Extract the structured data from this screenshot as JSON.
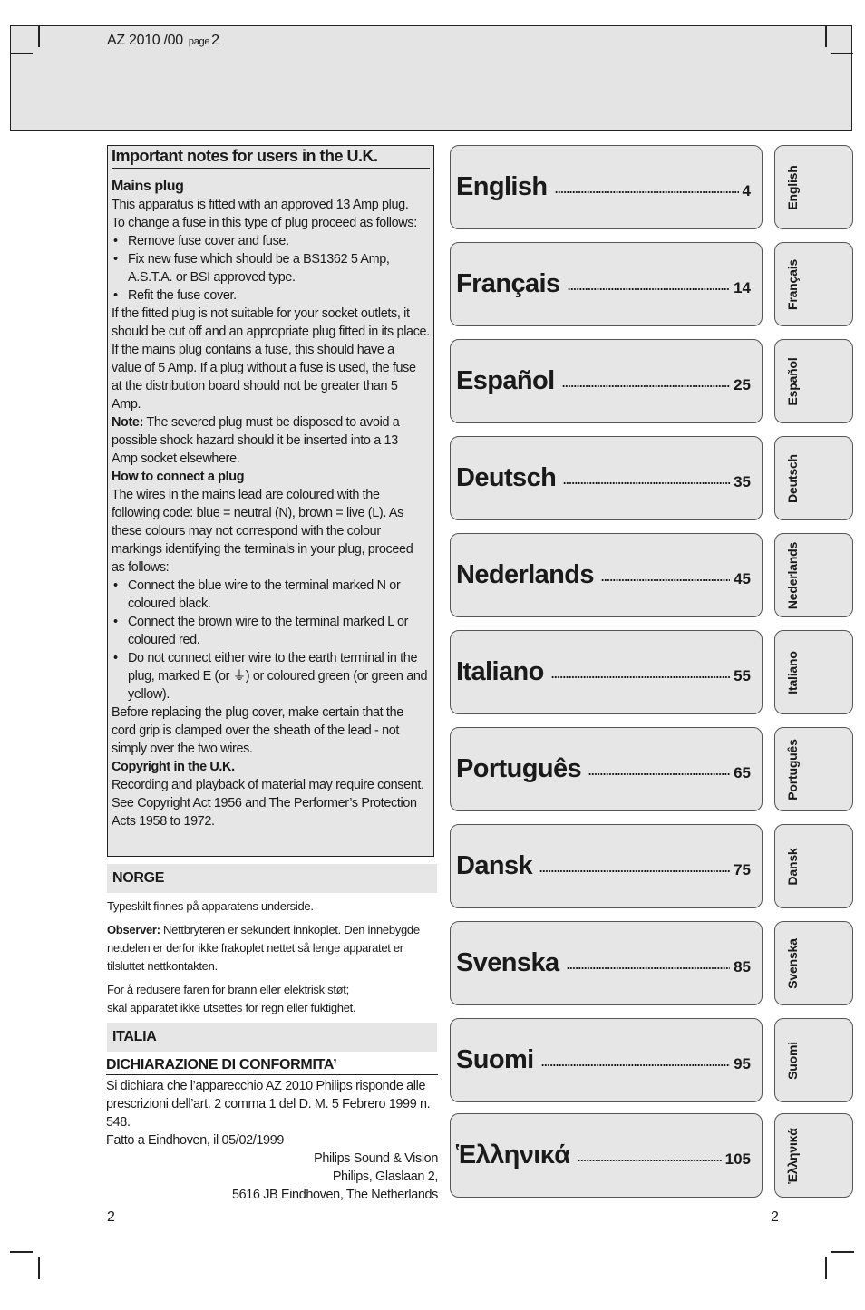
{
  "header": {
    "model": "AZ 2010 /00",
    "page_label": "page",
    "page_number": "2"
  },
  "uk_notes": {
    "title": "Important notes for users in the U.K.",
    "mains_plug_heading": "Mains plug",
    "intro_lines": [
      "This apparatus is fitted with an approved 13 Amp plug.",
      "To change a fuse in this type of plug proceed as follows:"
    ],
    "fuse_steps": [
      "Remove fuse cover and fuse.",
      "Fix new fuse which should be a BS1362 5 Amp, A.S.T.A. or BSI approved type.",
      "Refit the fuse cover."
    ],
    "para_not_suitable": "If the fitted plug is not suitable for your socket outlets, it should be cut off and an appropriate plug fitted in its place.",
    "para_fuse_value": "If the mains plug contains a fuse, this should have a value of 5 Amp. If a plug without a fuse is used, the fuse at the distribution board should not be greater than 5 Amp.",
    "note_label": "Note:",
    "note_text": " The severed plug must be disposed to avoid a possible shock hazard should it be inserted into a 13 Amp socket elsewhere.",
    "connect_heading": "How to connect a plug",
    "connect_intro": "The wires in the mains lead are coloured with the following code: blue = neutral (N), brown = live (L). As these colours may not correspond with the colour markings identifying the terminals in your plug, proceed as follows:",
    "connect_steps": [
      "Connect the blue wire to the terminal marked N or coloured black.",
      "Connect the brown wire to the terminal marked L or coloured red.",
      "Do not connect either wire to the earth terminal in the plug, marked E (or ⏚) or coloured green (or green and yellow)."
    ],
    "cover_text": "Before replacing the plug cover, make certain that the cord grip is clamped over the sheath of the lead - not simply over the two wires.",
    "copyright_heading": "Copyright in the U.K.",
    "copyright_text": "Recording and playback of material may require consent. See Copyright Act 1956 and The Performer’s Protection Acts 1958 to 1972."
  },
  "norge": {
    "heading": "NORGE",
    "line1": "Typeskilt finnes på apparatens underside.",
    "observer_label": "Observer:",
    "observer_text": " Nettbryteren er sekundert innkoplet. Den innebygde netdelen er derfor ikke frakoplet nettet så lenge apparatet er tilsluttet nettkontakten.",
    "warning_line1": "For å redusere faren for brann eller elektrisk støt;",
    "warning_line2": "skal apparatet ikke utsettes for regn eller fuktighet."
  },
  "italia": {
    "heading": "ITALIA",
    "declaration_title": "DICHIARAZIONE DI CONFORMITA’",
    "declaration_text": "Si dichiara che l’apparecchio AZ 2010 Philips risponde alle prescrizioni dell’art. 2 comma 1 del D. M. 5 Febrero 1999 n. 548.",
    "signed": "Fatto a Eindhoven, il 05/02/1999",
    "address": [
      "Philips Sound & Vision",
      "Philips, Glaslaan 2,",
      "5616 JB Eindhoven, The Netherlands"
    ]
  },
  "footer": {
    "left_page": "2",
    "right_page": "2"
  },
  "languages": [
    {
      "name": "English",
      "page": "4",
      "tab": "English"
    },
    {
      "name": "Français",
      "page": "14",
      "tab": "Français"
    },
    {
      "name": "Español",
      "page": "25",
      "tab": "Español"
    },
    {
      "name": "Deutsch",
      "page": "35",
      "tab": "Deutsch"
    },
    {
      "name": "Nederlands",
      "page": "45",
      "tab": "Nederlands"
    },
    {
      "name": "Italiano",
      "page": "55",
      "tab": "Italiano"
    },
    {
      "name": "Português",
      "page": "65",
      "tab": "Português"
    },
    {
      "name": "Dansk",
      "page": "75",
      "tab": "Dansk"
    },
    {
      "name": "Svenska",
      "page": "85",
      "tab": "Svenska"
    },
    {
      "name": "Suomi",
      "page": "95",
      "tab": "Suomi"
    },
    {
      "name": "Ἑλληνικά",
      "page": "105",
      "tab": "Ἑλληνικά"
    }
  ]
}
